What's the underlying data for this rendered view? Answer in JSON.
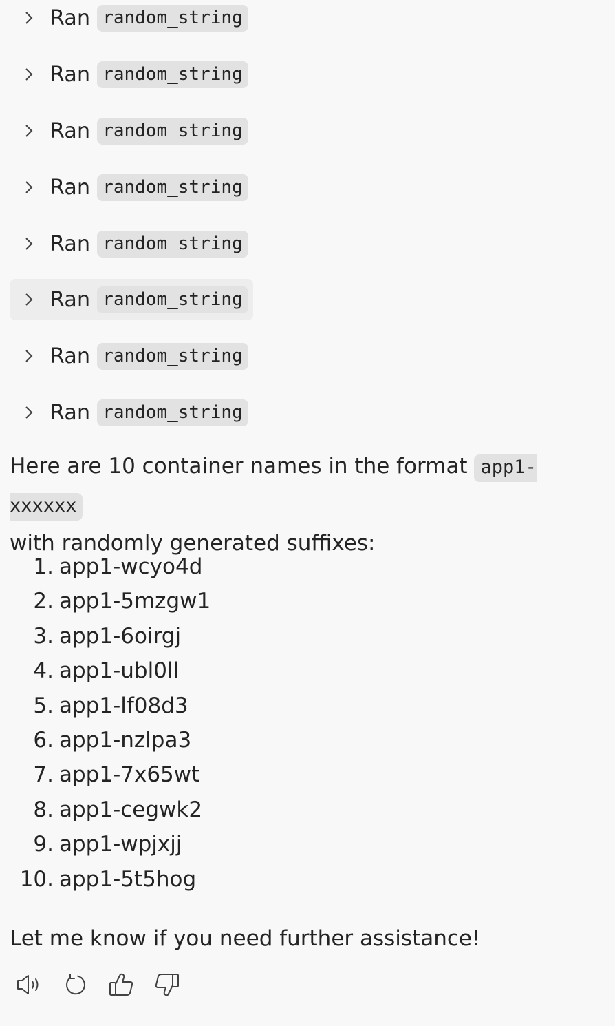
{
  "tool_calls": [
    {
      "ran": "Ran",
      "code": "random_string"
    },
    {
      "ran": "Ran",
      "code": "random_string"
    },
    {
      "ran": "Ran",
      "code": "random_string"
    },
    {
      "ran": "Ran",
      "code": "random_string"
    },
    {
      "ran": "Ran",
      "code": "random_string"
    },
    {
      "ran": "Ran",
      "code": "random_string"
    },
    {
      "ran": "Ran",
      "code": "random_string"
    },
    {
      "ran": "Ran",
      "code": "random_string"
    }
  ],
  "intro": {
    "before_code": "Here are 10 container names in the format ",
    "code": "app1-xxxxxx",
    "after_code": "with randomly generated suffixes:"
  },
  "names": [
    {
      "num": "1.",
      "value": "app1-wcyo4d"
    },
    {
      "num": "2.",
      "value": "app1-5mzgw1"
    },
    {
      "num": "3.",
      "value": "app1-6oirgj"
    },
    {
      "num": "4.",
      "value": "app1-ubl0ll"
    },
    {
      "num": "5.",
      "value": "app1-lf08d3"
    },
    {
      "num": "6.",
      "value": "app1-nzlpa3"
    },
    {
      "num": "7.",
      "value": "app1-7x65wt"
    },
    {
      "num": "8.",
      "value": "app1-cegwk2"
    },
    {
      "num": "9.",
      "value": "app1-wpjxjj"
    },
    {
      "num": "10.",
      "value": "app1-5t5hog"
    }
  ],
  "closing": "Let me know if you need further assistance!",
  "actions": {
    "icons": [
      "speaker-icon",
      "regenerate-icon",
      "thumbs-up-icon",
      "thumbs-down-icon"
    ]
  }
}
